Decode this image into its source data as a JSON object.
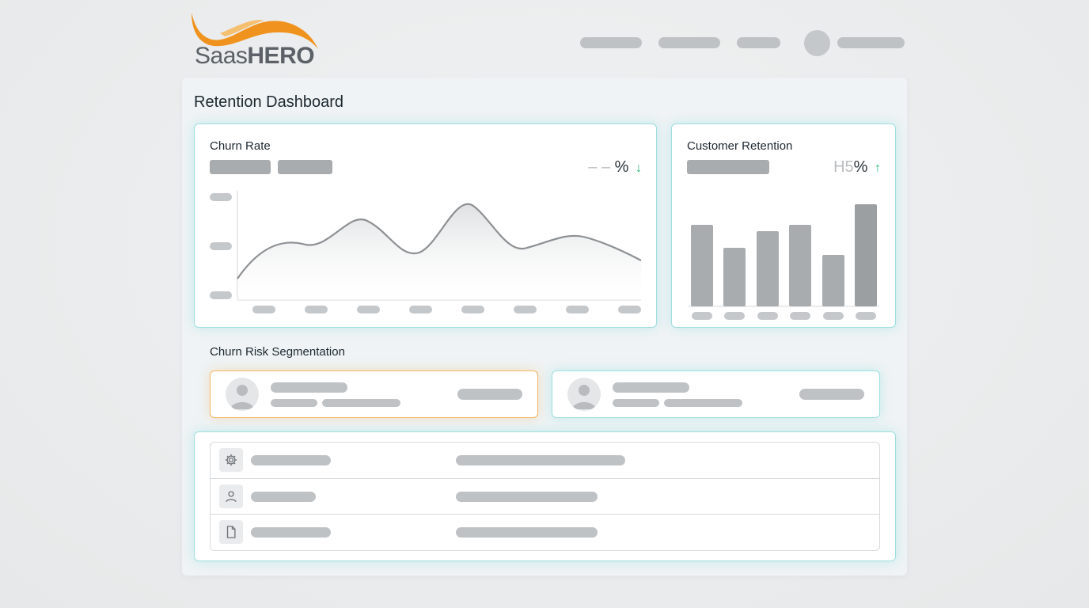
{
  "brand": {
    "logo_text_light": "Saas",
    "logo_text_bold": "HERO",
    "accent": "#f0931e"
  },
  "page": {
    "title": "Retention Dashboard"
  },
  "churn_card": {
    "title": "Churn Rate",
    "stat_placeholder": "– –",
    "stat_unit": "%",
    "trend": "↓"
  },
  "retention_card": {
    "title": "Customer Retention",
    "stat_value": "H5",
    "stat_unit": "%",
    "trend": "↑"
  },
  "segmentation": {
    "title": "Churn Risk Segmentation"
  },
  "table": {
    "rows": [
      {
        "icon": "gear-icon"
      },
      {
        "icon": "user-icon"
      },
      {
        "icon": "document-icon"
      }
    ]
  },
  "colors": {
    "card_border": "#9fdede",
    "highlight_border": "#f0b661",
    "trend_green": "#1fb573"
  }
}
